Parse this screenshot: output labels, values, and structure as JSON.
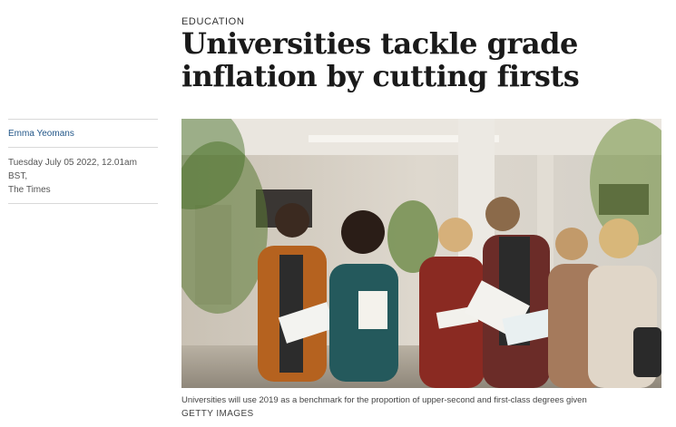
{
  "article": {
    "section": "EDUCATION",
    "headline": "Universities tackle grade inflation by cutting firsts",
    "author": "Emma Yeomans",
    "dateline_line1": "Tuesday July 05 2022, 12.01am BST,",
    "dateline_line2": "The Times",
    "caption": "Universities will use 2019 as a benchmark for the proportion of upper-second and first-class degrees given",
    "credit": "GETTY IMAGES"
  }
}
